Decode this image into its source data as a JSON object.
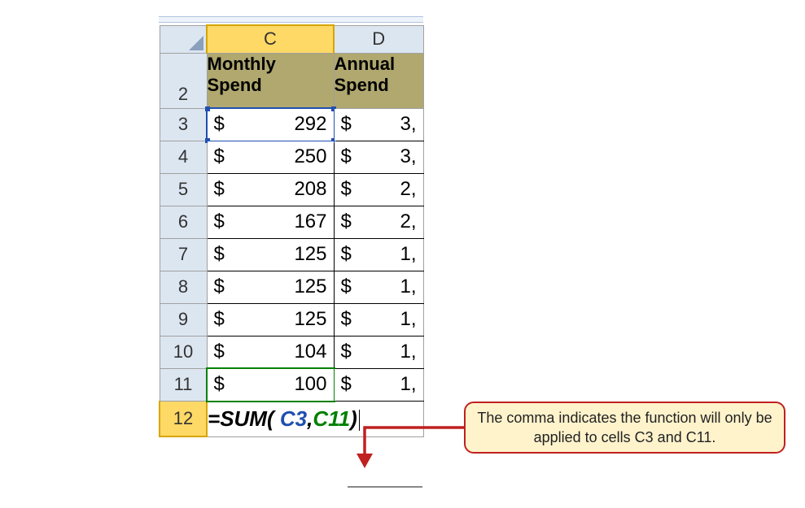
{
  "columns": {
    "c": "C",
    "d": "D"
  },
  "rows": [
    "2",
    "3",
    "4",
    "5",
    "6",
    "7",
    "8",
    "9",
    "10",
    "11",
    "12"
  ],
  "headers": {
    "c": "Monthly Spend",
    "d": "Annual Spend"
  },
  "data": {
    "c": [
      "292",
      "250",
      "208",
      "167",
      "125",
      "125",
      "125",
      "104",
      "100"
    ],
    "d": [
      "3,",
      "3,",
      "2,",
      "2,",
      "1,",
      "1,",
      "1,",
      "1,",
      "1,"
    ]
  },
  "formula": {
    "eq": "=",
    "name": "SUM",
    "open": "( ",
    "ref1": "C3",
    "comma": ",",
    "ref2": "C11",
    "close": ")"
  },
  "callout": "The comma indicates the function will only be applied to cells C3 and C11."
}
